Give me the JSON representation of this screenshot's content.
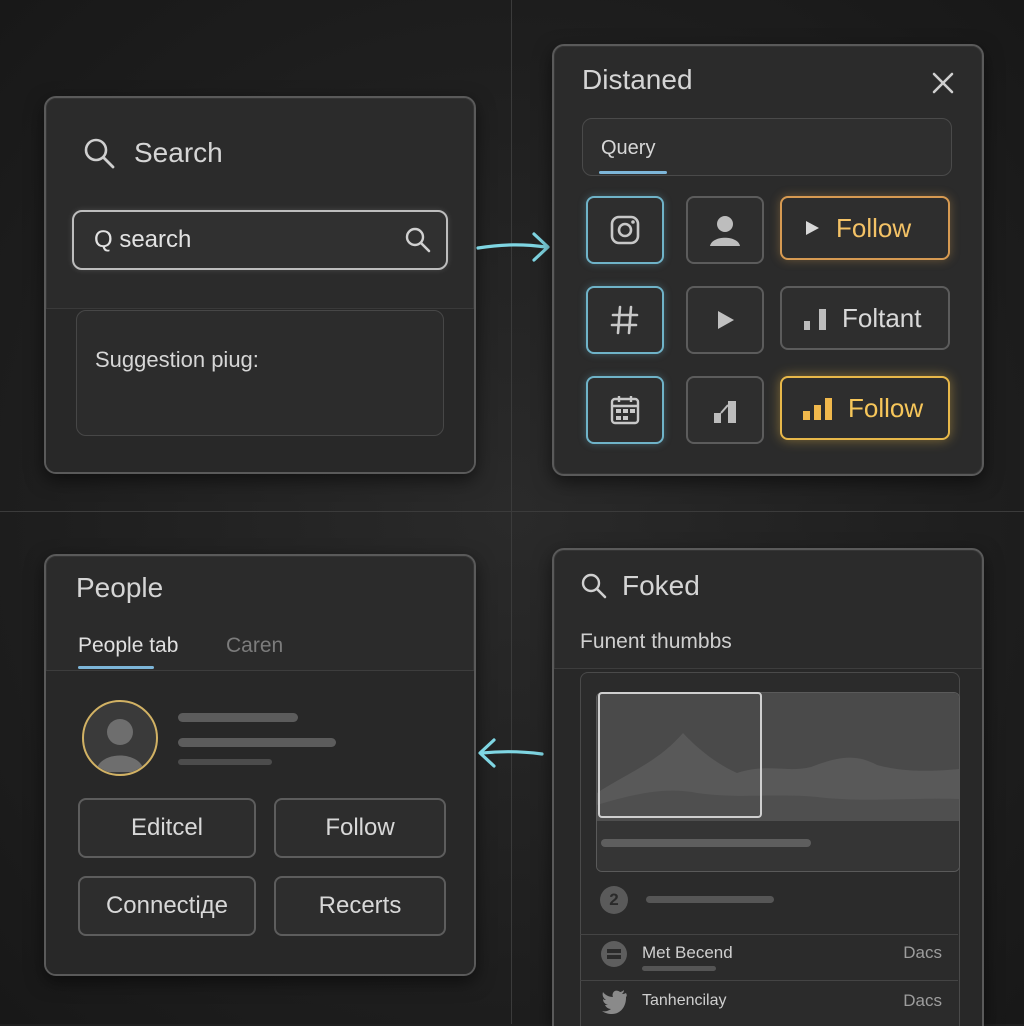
{
  "search_panel": {
    "title": "Search",
    "input_value": "Q search",
    "suggestion_label": "Suggestion piug:"
  },
  "distaned_panel": {
    "title": "Distaned",
    "query_label": "Query",
    "follow_top_label": "Follow",
    "foltant_label": "Foltant",
    "follow_bottom_label": "Follow",
    "icons": [
      "instagram-icon",
      "user-icon",
      "play-icon",
      "hashtag-icon",
      "play-icon",
      "bar-chart-icon",
      "calendar-icon",
      "bar-chart-icon",
      "bar-chart-icon"
    ]
  },
  "people_panel": {
    "title": "People",
    "tabs": [
      {
        "label": "People tab",
        "active": true
      },
      {
        "label": "Caren",
        "active": false
      }
    ],
    "buttons": {
      "editcel": "Editcel",
      "follow": "Follow",
      "connection": "Connectiде",
      "recents": "Recerts"
    }
  },
  "foked_panel": {
    "title": "Foked",
    "subtitle": "Funent thumbbs",
    "badge_number": "2",
    "rows": [
      {
        "label": "Met Becend",
        "meta": "Dacs",
        "icon": "square-circle-icon"
      },
      {
        "label": "Tanhencilay",
        "meta": "Dacs",
        "icon": "twitter-icon"
      }
    ]
  },
  "colors": {
    "background": "#1f1f1f",
    "panel": "#2b2b2b",
    "accent_cyan": "#6fb3c8",
    "accent_orange": "#d79a52",
    "accent_gold": "#e8b84a",
    "tab_underline": "#7db6d9"
  }
}
